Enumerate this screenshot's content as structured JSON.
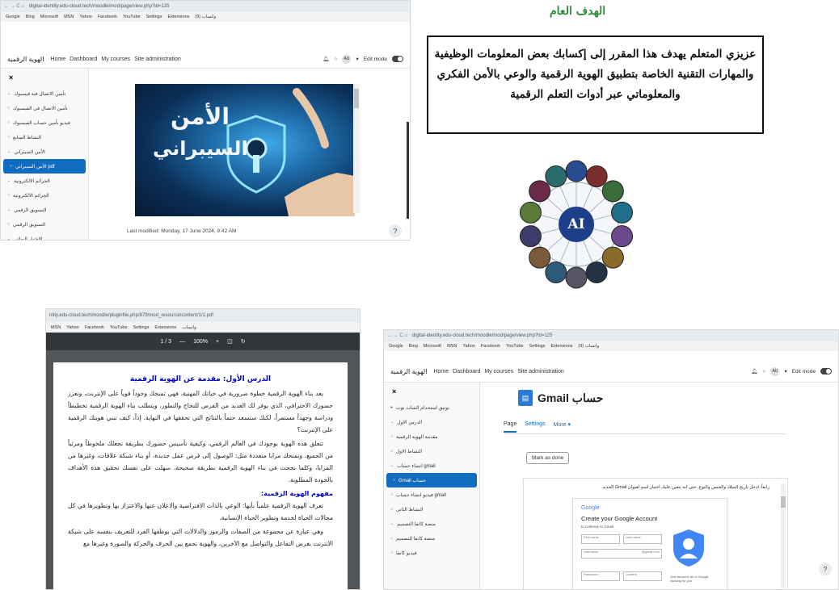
{
  "cyber_window": {
    "url": "digital-identity.edu-cloud.tech/moodle/mod/page/view.php?id=125",
    "bookmarks": [
      "Google",
      "Bing",
      "Microsoft",
      "MSN",
      "Yahoo",
      "Facebook",
      "YouTube",
      "Settings",
      "Extensions",
      "واتساب (9)"
    ],
    "brand": "الهوية الرقمية",
    "nav_links": [
      "Home",
      "Dashboard",
      "My courses",
      "Site administration"
    ],
    "user": "AU",
    "edit_mode": "Edit mode",
    "close": "×",
    "drawer_items": [
      {
        "label": "تأمين الاتصال فيه فيسبوك",
        "mark": "⌄",
        "selected": false
      },
      {
        "label": "تأمين الاتصال في الفيسبوك",
        "mark": "○",
        "selected": false
      },
      {
        "label": "فيديو تأمين حساب الفيسبوك",
        "mark": "○",
        "selected": false
      },
      {
        "label": "النشاط السابع",
        "mark": "○",
        "selected": false
      },
      {
        "label": "الأمن السيبراني",
        "mark": "⌄",
        "selected": false
      },
      {
        "label": "pdf الأمن السيبراني",
        "mark": "○",
        "selected": true
      },
      {
        "label": "الجرائم الالكترونية",
        "mark": "⌄",
        "selected": false
      },
      {
        "label": "الجرائم الالكترونية",
        "mark": "○",
        "selected": false
      },
      {
        "label": "التسويق الرقمي",
        "mark": "⌄",
        "selected": false
      },
      {
        "label": "التسويق الرقمي",
        "mark": "○",
        "selected": false
      },
      {
        "label": "الاختبار النهائي",
        "mark": "⌄",
        "selected": false
      }
    ],
    "image_title_1": "الأمن",
    "image_title_2": "السيبراني",
    "last_modified": "Last modified: Monday, 17 June 2024, 9:42 AM",
    "help": "?"
  },
  "goal": {
    "title": "الهدف العام",
    "text": "عزيزي المتعلم يهدف هذا المقرر إلى إكسابك بعض المعلومات الوظيفية والمهارات التقنية الخاصة بتطبيق الهوية الرقمية والوعي بالأمن الفكري والمعلوماتي عبر أدوات التعلم الرقمية",
    "ai_label": "AI"
  },
  "pdf_window": {
    "url": "ntity.edu-cloud.tech/moodle/pluginfile.php/879/mod_resource/content/1/1.pdf",
    "bookmarks": [
      "MSN",
      "Yahoo",
      "Facebook",
      "YouTube",
      "Settings",
      "Extensions",
      "واتساب"
    ],
    "page_indicator": "1 / 3",
    "zoom": "100%",
    "zoom_minus": "—",
    "zoom_plus": "+",
    "heading": "الدرس الأول: مقدمة عن الهوية الرقمية",
    "para1": "بعد بناء الهوية الرقمية خطوة ضرورية في حياتك المهنية، فهي تمنحك وجوداً قوياً على الإنترنت، وتعزز حضورك الاحترافي، الذي يوفر لك العديد من الفرص للنجاح والتطور، ويتطلب بناء الهوية الرقمية تخطيطاً ودراسة وجهداً مستمراً، لكنك ستسعد حتماً بالنتائج التي تحققها في النهاية. إذاً، كيف تبني هويتك الرقمية على الإنترنت؟",
    "para2": "تتعلق هذه الهوية بوجودك في العالم الرقمي، وكيفية تأسيس حضورك بطريقة تجعلك ملحوظاً ومرئياً من الجميع، وتمنحك مزايا متعددة مثل: الوصول إلى فرص عمل جديدة، أو بناء شبكة علاقات، وغيرها من المزايا، وكلما نجحت في بناء الهوية الرقمية بطريقة صحيحة، سهلت على نفسك تحقيق هذه الأهداف بالجودة المطلوبة.",
    "subheading": "مفهوم الهوية الرقمية:",
    "para3": "تعرف الهوية الرقمية علمياً بأنها: الوعي بالذات الافتراضية والاعلان عنها والاعتزاز بها وتطويرها في كل مجالات الحياة لخدمة وتطوير الحياة الإنسانية.",
    "para4": "وهي عبارة عن مجموعة من الصفات والرموز والدلالات التي يوظفها الفرد للتعريف بنفسه على شبكة الانترنت بغرض التفاعل والتواصل مع الآخرين، والهوية تجمع بين الحرف والحركة والصورة وغيرها مع"
  },
  "gmail_window": {
    "url": "digital-identity.edu-cloud.tech/moodle/mod/page/view.php?id=125",
    "bookmarks": [
      "Google",
      "Bing",
      "Microsoft",
      "MSN",
      "Yahoo",
      "Facebook",
      "YouTube",
      "Settings",
      "Extensions",
      "واتساب (9)"
    ],
    "brand": "الهوية الرقمية",
    "nav_links": [
      "Home",
      "Dashboard",
      "My courses",
      "Site administration"
    ],
    "user": "AU",
    "edit_mode": "Edit mode",
    "close": "×",
    "page_title": "Gmail حساب",
    "tabs": [
      "Page",
      "Settings",
      "More ▾"
    ],
    "mark_done": "Mark as done",
    "drawer_items": [
      {
        "label": "توثيق استخدام الشات بوت",
        "mark": "●",
        "selected": false
      },
      {
        "label": "الدرس الاول",
        "mark": "⌄",
        "selected": false
      },
      {
        "label": "مقدمة الهوية الرقمية",
        "mark": "○",
        "selected": false
      },
      {
        "label": "النشاط الاول",
        "mark": "○",
        "selected": false
      },
      {
        "label": "gmail انشاء حساب",
        "mark": "⌄",
        "selected": false
      },
      {
        "label": "حساب Gmail",
        "mark": "○",
        "selected": true
      },
      {
        "label": "gmail فيديو انشاء حساب",
        "mark": "○",
        "selected": false
      },
      {
        "label": "النشاط الثاني",
        "mark": "○",
        "selected": false
      },
      {
        "label": "منصة كانفا التصميم",
        "mark": "⌄",
        "selected": false
      },
      {
        "label": "منصة كانفا للتصميم",
        "mark": "○",
        "selected": false
      },
      {
        "label": "فيديو كانفا",
        "mark": "○",
        "selected": false
      }
    ],
    "embed_caption": "رابعاً: ادخل تاريخ الميلاد والجنس والنوع، حتى انه يتعين عليك اختيار اسم لعنوان Gmail الجديد",
    "google_logo": "Google",
    "create_account": "Create your Google Account",
    "continue_to": "to continue to Gmail",
    "first_name": "First name",
    "last_name": "Last name",
    "username": "Username",
    "gmail_suffix": "@gmail.com",
    "password": "Password",
    "confirm": "Confirm",
    "one_account": "One account. All of Google working for you.",
    "help": "?"
  }
}
